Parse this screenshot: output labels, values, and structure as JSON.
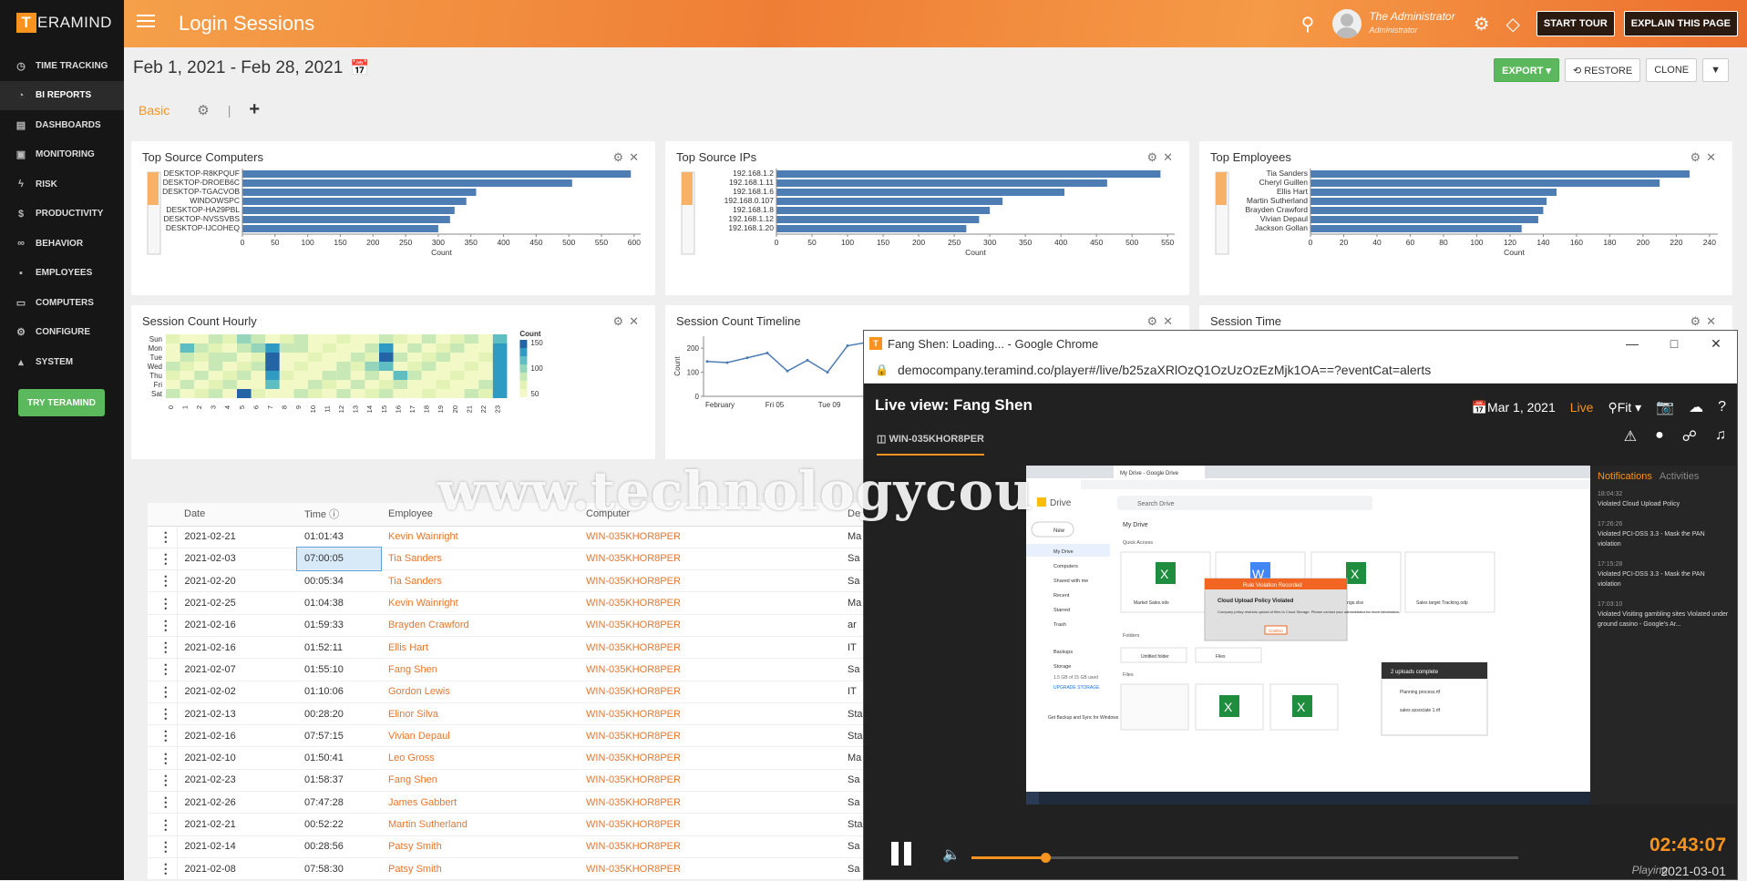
{
  "app": {
    "logo_text": "ERAMIND",
    "logo_letter": "T",
    "page_title": "Login Sessions"
  },
  "sidebar": {
    "items": [
      {
        "label": "TIME TRACKING",
        "icon": "clock-icon"
      },
      {
        "label": "BI REPORTS",
        "icon": "pie-icon",
        "active": true
      },
      {
        "label": "DASHBOARDS",
        "icon": "dashboard-icon"
      },
      {
        "label": "MONITORING",
        "icon": "monitor-icon"
      },
      {
        "label": "RISK",
        "icon": "bolt-icon"
      },
      {
        "label": "PRODUCTIVITY",
        "icon": "dollar-icon"
      },
      {
        "label": "BEHAVIOR",
        "icon": "binoculars-icon"
      },
      {
        "label": "EMPLOYEES",
        "icon": "user-icon"
      },
      {
        "label": "COMPUTERS",
        "icon": "computer-icon"
      },
      {
        "label": "CONFIGURE",
        "icon": "gear-icon"
      },
      {
        "label": "SYSTEM",
        "icon": "system-icon"
      }
    ],
    "try_label": "TRY TERAMIND"
  },
  "header": {
    "user_name": "The Administrator",
    "user_role": "Administrator",
    "start_tour": "START TOUR",
    "explain": "EXPLAIN THIS PAGE"
  },
  "toolbar": {
    "date_range": "Feb 1, 2021 - Feb 28, 2021",
    "export": "EXPORT ▾",
    "restore": "⟲ RESTORE",
    "clone": "CLONE",
    "tab_basic": "Basic"
  },
  "panels": {
    "top_source_computers": "Top Source Computers",
    "top_source_ips": "Top Source IPs",
    "top_employees": "Top Employees",
    "session_count_hourly": "Session Count Hourly",
    "session_count_timeline": "Session Count Timeline",
    "session_time": "Session Time"
  },
  "chart_data": [
    {
      "type": "bar",
      "orientation": "horizontal",
      "title": "Top Source Computers",
      "xlabel": "Count",
      "categories": [
        "DESKTOP-R8KPQUF",
        "DESKTOP-DROEB6C",
        "DESKTOP-TGACVOB",
        "WINDOWSPC",
        "DESKTOP-HA29PBL",
        "DESKTOP-NVSSVBS",
        "DESKTOP-IJCOHEQ"
      ],
      "values": [
        595,
        505,
        358,
        343,
        325,
        318,
        300
      ],
      "xticks": [
        0,
        50,
        100,
        150,
        200,
        250,
        300,
        350,
        400,
        450,
        500,
        550,
        600
      ],
      "xlim": [
        0,
        610
      ]
    },
    {
      "type": "bar",
      "orientation": "horizontal",
      "title": "Top Source IPs",
      "xlabel": "Count",
      "categories": [
        "192.168.1.2",
        "192.168.1.11",
        "192.168.1.6",
        "192.168.0.107",
        "192.168.1.8",
        "192.168.1.12",
        "192.168.1.20"
      ],
      "values": [
        540,
        465,
        405,
        318,
        300,
        285,
        267
      ],
      "xticks": [
        0,
        50,
        100,
        150,
        200,
        250,
        300,
        350,
        400,
        450,
        500,
        550
      ],
      "xlim": [
        0,
        560
      ]
    },
    {
      "type": "bar",
      "orientation": "horizontal",
      "title": "Top Employees",
      "xlabel": "Count",
      "categories": [
        "Tia Sanders",
        "Cheryl Guillen",
        "Ellis Hart",
        "Martin Sutherland",
        "Brayden Crawford",
        "Vivian Depaul",
        "Jackson Gollan"
      ],
      "values": [
        228,
        210,
        148,
        142,
        140,
        137,
        127
      ],
      "xticks": [
        0,
        20,
        40,
        60,
        80,
        100,
        120,
        140,
        160,
        180,
        200,
        220,
        240
      ],
      "xlim": [
        0,
        245
      ]
    },
    {
      "type": "heatmap",
      "title": "Session Count Hourly",
      "rows": [
        "Sun",
        "Mon",
        "Tue",
        "Wed",
        "Thu",
        "Fri",
        "Sat"
      ],
      "cols": [
        "0",
        "1",
        "2",
        "3",
        "4",
        "5",
        "6",
        "7",
        "8",
        "9",
        "10",
        "11",
        "12",
        "13",
        "14",
        "15",
        "16",
        "17",
        "18",
        "19",
        "20",
        "21",
        "22",
        "23"
      ],
      "legend_title": "Count",
      "legend_ticks": [
        150,
        100,
        50
      ]
    },
    {
      "type": "line",
      "title": "Session Count Timeline",
      "ylabel": "Count",
      "yticks": [
        0,
        100,
        200
      ],
      "xticks": [
        "February",
        "Fri 05",
        "Tue 09"
      ],
      "values": [
        145,
        140,
        160,
        180,
        105,
        150,
        100,
        210,
        225
      ]
    }
  ],
  "table": {
    "headers": [
      "Date",
      "Time",
      "Employee",
      "Computer",
      "De"
    ],
    "rows": [
      [
        "2021-02-21",
        "01:01:43",
        "Kevin Wainright",
        "WIN-035KHOR8PER",
        "Ma"
      ],
      [
        "2021-02-03",
        "07:00:05",
        "Tia Sanders",
        "WIN-035KHOR8PER",
        "Sa"
      ],
      [
        "2021-02-20",
        "00:05:34",
        "Tia Sanders",
        "WIN-035KHOR8PER",
        "Sa"
      ],
      [
        "2021-02-25",
        "01:04:38",
        "Kevin Wainright",
        "WIN-035KHOR8PER",
        "Ma"
      ],
      [
        "2021-02-16",
        "01:59:33",
        "Brayden Crawford",
        "WIN-035KHOR8PER",
        "ar"
      ],
      [
        "2021-02-16",
        "01:52:11",
        "Ellis Hart",
        "WIN-035KHOR8PER",
        "IT"
      ],
      [
        "2021-02-07",
        "01:55:10",
        "Fang Shen",
        "WIN-035KHOR8PER",
        "Sa"
      ],
      [
        "2021-02-02",
        "01:10:06",
        "Gordon Lewis",
        "WIN-035KHOR8PER",
        "IT"
      ],
      [
        "2021-02-13",
        "00:28:20",
        "Elinor Silva",
        "WIN-035KHOR8PER",
        "Sta"
      ],
      [
        "2021-02-16",
        "07:57:15",
        "Vivian Depaul",
        "WIN-035KHOR8PER",
        "Sta"
      ],
      [
        "2021-02-10",
        "01:50:41",
        "Leo Gross",
        "WIN-035KHOR8PER",
        "Ma"
      ],
      [
        "2021-02-23",
        "01:58:37",
        "Fang Shen",
        "WIN-035KHOR8PER",
        "Sa"
      ],
      [
        "2021-02-26",
        "07:47:28",
        "James Gabbert",
        "WIN-035KHOR8PER",
        "Sa"
      ],
      [
        "2021-02-21",
        "00:52:22",
        "Martin Sutherland",
        "WIN-035KHOR8PER",
        "Sta"
      ],
      [
        "2021-02-14",
        "00:28:56",
        "Patsy Smith",
        "WIN-035KHOR8PER",
        "Sa"
      ],
      [
        "2021-02-08",
        "07:58:30",
        "Patsy Smith",
        "WIN-035KHOR8PER",
        "Sa"
      ]
    ]
  },
  "popup": {
    "window_title": "Fang Shen: Loading... - Google Chrome",
    "url": "democompany.teramind.co/player#/live/b25zaXRlOzQ1OzUzOzEzMjk1OA==?eventCat=alerts",
    "heading": "Live view: Fang Shen",
    "date": "Mar 1, 2021",
    "live": "Live",
    "fit": "Fit ▾",
    "computer_tab": "WIN-035KHOR8PER",
    "tabs": [
      "Notifications",
      "Activities"
    ],
    "notifications": [
      {
        "time": "18:04:32",
        "text": "Violated Cloud Upload Policy"
      },
      {
        "time": "17:26:26",
        "text": "Violated PCI-DSS 3.3 - Mask the PAN violation"
      },
      {
        "time": "17:15:28",
        "text": "Violated PCI-DSS 3.3 - Mask the PAN violation"
      },
      {
        "time": "17:03:10",
        "text": "Violated Visiting gambling sites Violated under ground casino - Google's Ar..."
      }
    ],
    "time": "02:43:07",
    "status": "Playing",
    "playdate": "2021-03-01",
    "progress": 0.135,
    "screen": {
      "title": "My Drive - Google Drive",
      "app": "Drive",
      "search": "Search Drive",
      "new": "New",
      "mydrive": "My Drive",
      "quick": "Quick Access",
      "nav": [
        "My Drive",
        "Computers",
        "Shared with me",
        "Recent",
        "Starred",
        "Trash",
        "Backups",
        "Storage"
      ],
      "storage": "1.5 GB of 15 GB used",
      "upgrade": "UPGRADE STORAGE",
      "alert_title": "Rule Violation Recorded",
      "alert_head": "Cloud Upload Policy Violated",
      "alert_text": "Company policy restricts upload of files to Cloud Storage. Please contact your administrator for more information.",
      "alert_btn": "Confirm",
      "uploads": "2 uploads complete",
      "up1": "Planning process.rtf",
      "up2": "sales associate 1.rtf",
      "file1": "Market Sales.ods",
      "file2": "billings.xlsx",
      "file3": "Sales target Tracking.odp",
      "folders": "Folders",
      "files": "Files",
      "folder1": "Untitled folder",
      "folder2": "Files",
      "get_backup": "Get Backup and Sync for Windows"
    }
  },
  "watermark": "www.technologycou"
}
